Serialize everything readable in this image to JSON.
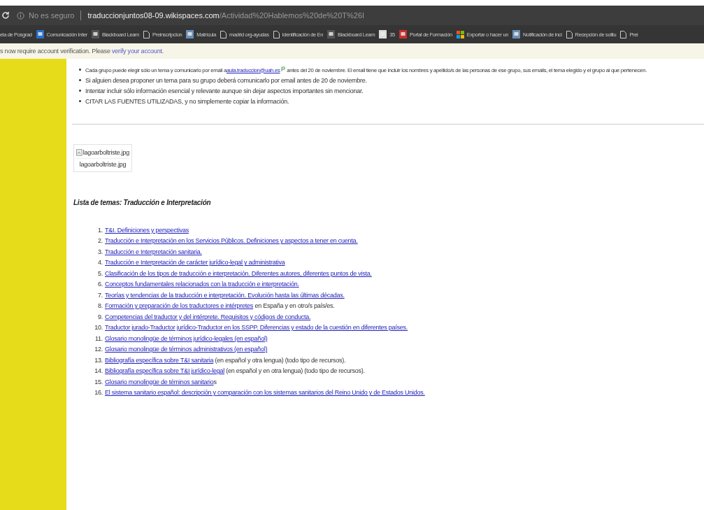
{
  "browser": {
    "security": "No es seguro",
    "url_host": "traduccionjuntos08-09.wikispaces.com",
    "url_path": "/Actividad%20Hablemos%20de%20T%26I"
  },
  "bookmarks": [
    {
      "label": "ela de Posgrad",
      "kind": "none"
    },
    {
      "label": "Comunicación Inter",
      "kind": "people"
    },
    {
      "label": "Blackboard Learn",
      "kind": "board"
    },
    {
      "label": "Preinscripcion",
      "kind": "page"
    },
    {
      "label": "Matrícula",
      "kind": "doc"
    },
    {
      "label": "madrid org-ayudas",
      "kind": "page"
    },
    {
      "label": "Identificación de En",
      "kind": "page"
    },
    {
      "label": "Blackboard Learn",
      "kind": "board"
    },
    {
      "label": "35",
      "kind": "note"
    },
    {
      "label": "Portal de Formación",
      "kind": "cross"
    },
    {
      "label": "Exportar o hacer un",
      "kind": "tiles"
    },
    {
      "label": "Notificación de inci",
      "kind": "doc"
    },
    {
      "label": "Recepción de solitu",
      "kind": "page"
    },
    {
      "label": "Prei",
      "kind": "page"
    }
  ],
  "notice": {
    "text": "s now require account verification. Please",
    "link": "verify your account."
  },
  "bullets": [
    {
      "before": "Cada grupo puede elegir sólo un tema y comunicarlo por email a",
      "link": "aula.traduccion@uah.es",
      "after": "antes del 20 de noviembre. El email tiene que incluir los nombres y apellido/s de las personas de ese grupo, sus emails, el tema elegido y el grupo al que pertenecen."
    },
    {
      "before": "Si alguien desea proponer un tema para su grupo deberá comunicarlo por email antes de 20 de noviembre."
    },
    {
      "before": "Intentar incluir sólo información esencial y relevante aunque sin dejar aspectos importantes sin mencionar."
    },
    {
      "before": "CITAR LAS FUENTES UTILIZADAS, y no simplemente copiar la información."
    }
  ],
  "image": {
    "alt": "lagoarboltriste.jpg",
    "caption": "lagoarboltriste.jpg"
  },
  "heading": "Lista de temas: Traducción e Interpretación",
  "topics": [
    {
      "number": "1.",
      "link": "T&I. Definiciones y perspectivas"
    },
    {
      "number": "2.",
      "link": "Traducción e Interpretación en los Servicios Públicos. Definiciones y aspectos a tener en cuenta."
    },
    {
      "number": "3.",
      "link": "Traducción e Interpretación sanitaria."
    },
    {
      "number": "4.",
      "link": "Traducción e Interpretación de carácter jurídico-legal y administrativa"
    },
    {
      "number": "5.",
      "link": "Clasificación de los tipos de traducción e interpretación. Diferentes autores, diferentes puntos de vista."
    },
    {
      "number": "6.",
      "link": "Conceptos fundamentales relacionados con la traducción e interpretación."
    },
    {
      "number": "7.",
      "link": "Teorías y tendencias de la traducción e interpretación. Evolución hasta las últimas décadas."
    },
    {
      "number": "8.",
      "link": "Formación y preparación de los traductores e intérpretes",
      "rest": " en España y en otro/s país/es."
    },
    {
      "number": "9.",
      "link": "Competencias del traductor y del intérprete. Requisitos y códigos de conducta."
    },
    {
      "number": "10.",
      "link": "Traductor jurado-Traductor jurídico-Traductor en los SSPP. Diferencias y estado de la cuestión en diferentes países."
    },
    {
      "number": "11.",
      "link": "Glosario monolingüe de términos jurídico-legales (en español)"
    },
    {
      "number": "12.",
      "link": "Glosario monolingüe de términos administrativos (en español)"
    },
    {
      "number": "13.",
      "link": "Bibliografía específica sobre T&I sanitaria",
      "rest": " (en español y otra lengua) (todo tipo de recursos)."
    },
    {
      "number": "14.",
      "link": "Bibliografía específica sobre T&I jurídico-legal",
      "rest": " (en español y en otra lengua) (todo tipo de recursos)."
    },
    {
      "number": "15.",
      "link": "Glosario monolingüe de téminos sanitario",
      "rest": "s"
    },
    {
      "number": "16.",
      "link": "El sistema sanitario español: descripción y comparación con los sistemas sanitarios del Reino Unido y de Estados Unidos."
    }
  ]
}
